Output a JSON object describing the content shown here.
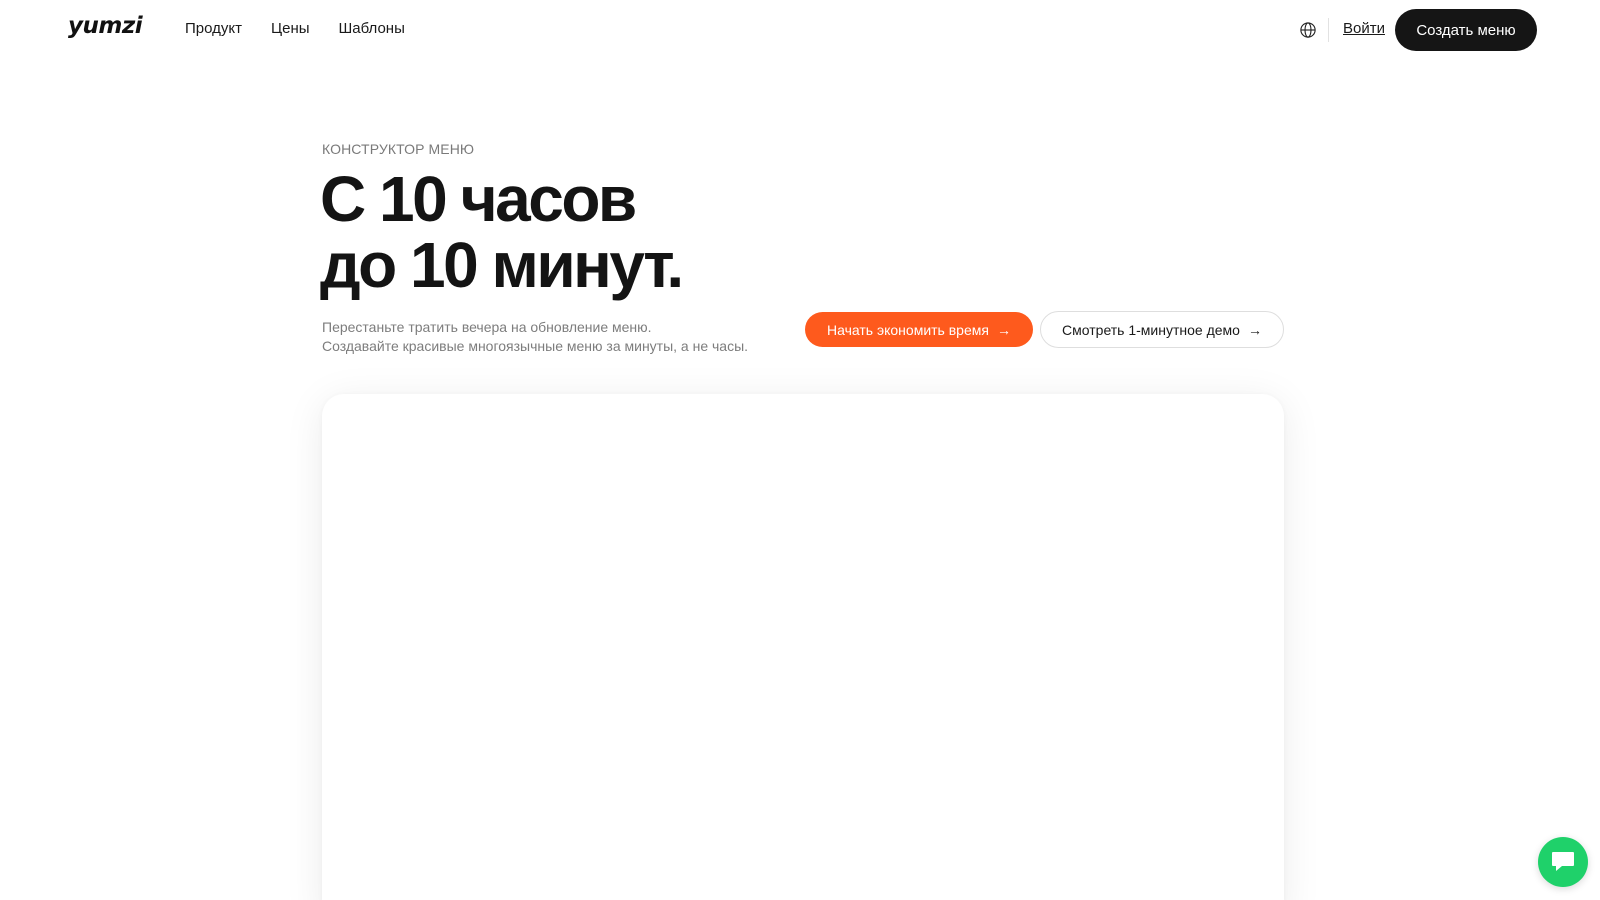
{
  "header": {
    "logo": "yumzi",
    "nav": [
      "Продукт",
      "Цены",
      "Шаблоны"
    ],
    "language_icon": "globe-icon",
    "login_label": "Войти",
    "create_label": "Создать меню"
  },
  "hero": {
    "eyebrow": "КОНСТРУКТОР МЕНЮ",
    "headline_line1": "С 10 часов",
    "headline_line2": "до 10 минут.",
    "subtext_line1": "Перестаньте тратить вечера на обновление меню.",
    "subtext_line2": "Создавайте красивые многоязычные меню за минуты, а не часы.",
    "cta_primary": "Начать экономить время",
    "cta_secondary": "Смотреть 1-минутное демо",
    "arrow_icon": "arrow-right-icon"
  },
  "chat_widget": {
    "icon": "chat-icon",
    "color": "#1fd16a"
  },
  "colors": {
    "accent": "#fe5a1d",
    "dark_button": "#151515"
  }
}
